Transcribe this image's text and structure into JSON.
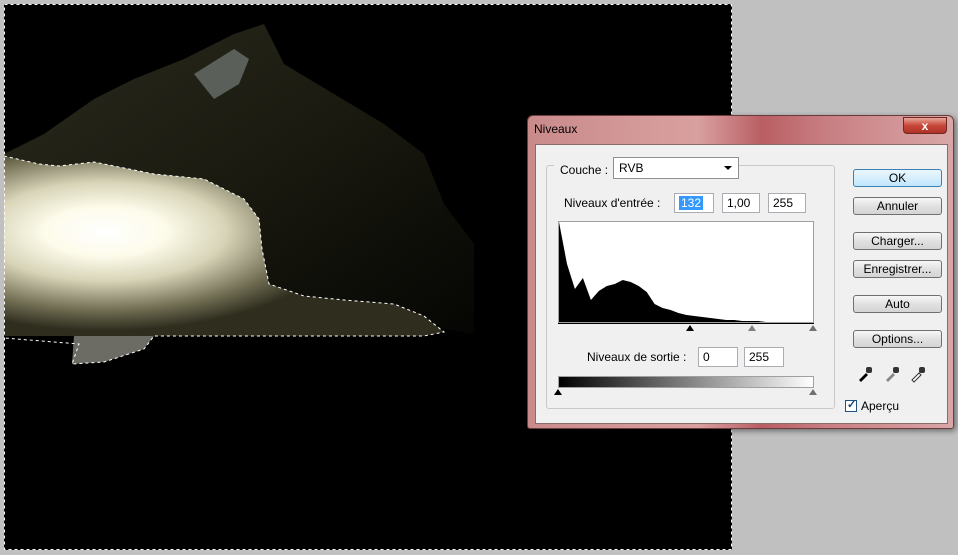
{
  "dialog": {
    "title": "Niveaux",
    "close_label": "x",
    "channel": {
      "label": "Couche :",
      "value": "RVB"
    },
    "input_levels": {
      "label": "Niveaux d'entrée :",
      "black": "132",
      "gamma": "1,00",
      "white": "255"
    },
    "output_levels": {
      "label": "Niveaux de sortie :",
      "black": "0",
      "white": "255"
    },
    "buttons": {
      "ok": "OK",
      "cancel": "Annuler",
      "load": "Charger...",
      "save": "Enregistrer...",
      "auto": "Auto",
      "options": "Options..."
    },
    "preview": {
      "label": "Aperçu",
      "checked": true
    },
    "eyedroppers": [
      "black-eyedropper",
      "gray-eyedropper",
      "white-eyedropper"
    ]
  },
  "chart_data": {
    "type": "area",
    "x": [
      0,
      8,
      16,
      24,
      32,
      40,
      48,
      56,
      64,
      72,
      80,
      88,
      96,
      104,
      112,
      120,
      128,
      136,
      144,
      152,
      160,
      168,
      176,
      184,
      192,
      200,
      208,
      216,
      224,
      232,
      240,
      248,
      255
    ],
    "values": [
      100,
      58,
      33,
      44,
      22,
      31,
      36,
      38,
      42,
      40,
      36,
      30,
      18,
      14,
      12,
      9,
      7,
      6,
      5,
      4,
      3,
      2,
      2,
      1,
      1,
      1,
      0,
      0,
      0,
      0,
      0,
      0,
      0
    ],
    "xlim": [
      0,
      255
    ],
    "ylim": [
      0,
      100
    ],
    "color": "#000000",
    "background": "#ffffff"
  }
}
